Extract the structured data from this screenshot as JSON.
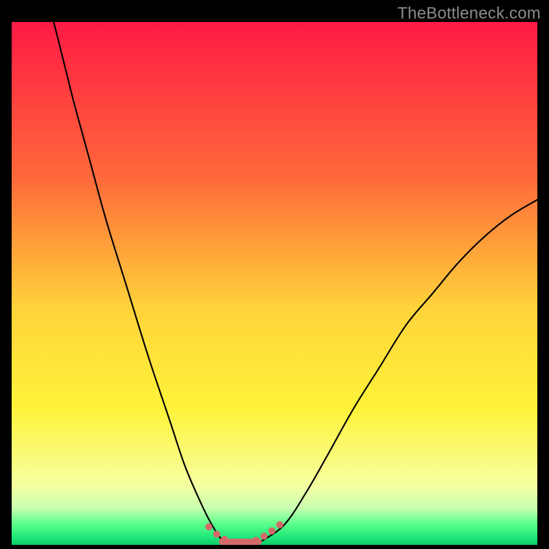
{
  "watermark": {
    "text": "TheBottleneck.com"
  },
  "colors": {
    "bg": "#000000",
    "watermark": "#8c8c8c",
    "curve": "#000000",
    "marker_stroke": "#d36a6a",
    "marker_fill": "#d36a6a",
    "gradient_stops": [
      {
        "offset": 0,
        "color": "#ff1a44"
      },
      {
        "offset": 0.3,
        "color": "#ff6a3a"
      },
      {
        "offset": 0.55,
        "color": "#ffd43a"
      },
      {
        "offset": 0.74,
        "color": "#fff33a"
      },
      {
        "offset": 0.885,
        "color": "#f6ffa0"
      },
      {
        "offset": 0.93,
        "color": "#c8ffb0"
      },
      {
        "offset": 0.96,
        "color": "#5aff8a"
      },
      {
        "offset": 0.985,
        "color": "#20e87a"
      },
      {
        "offset": 1.0,
        "color": "#0acc66"
      }
    ]
  },
  "chart_data": {
    "type": "line",
    "title": "",
    "xlabel": "",
    "ylabel": "",
    "xlim": [
      0,
      100
    ],
    "ylim": [
      0,
      100
    ],
    "series": [
      {
        "name": "bottleneck-curve",
        "x": [
          8,
          10,
          12,
          15,
          18,
          22,
          26,
          30,
          33,
          36,
          38,
          40,
          42,
          44,
          46,
          48,
          52,
          56,
          60,
          65,
          70,
          75,
          80,
          85,
          90,
          95,
          100
        ],
        "y": [
          100,
          92,
          84,
          73,
          62,
          49,
          36,
          24,
          15,
          8,
          4,
          1,
          0,
          0,
          0,
          1,
          4,
          10,
          17,
          26,
          34,
          42,
          48,
          54,
          59,
          63,
          66
        ]
      }
    ],
    "markers": {
      "name": "green-zone-markers",
      "x": [
        37.5,
        39.0,
        40.5,
        42.0,
        45.0,
        46.5,
        48.0,
        49.5,
        51.0
      ],
      "y": [
        3.2,
        1.8,
        0.8,
        0.2,
        0.2,
        0.6,
        1.4,
        2.4,
        3.6
      ]
    },
    "flat_segment": {
      "x0": 40.0,
      "x1": 47.0,
      "y": 0.0
    }
  }
}
